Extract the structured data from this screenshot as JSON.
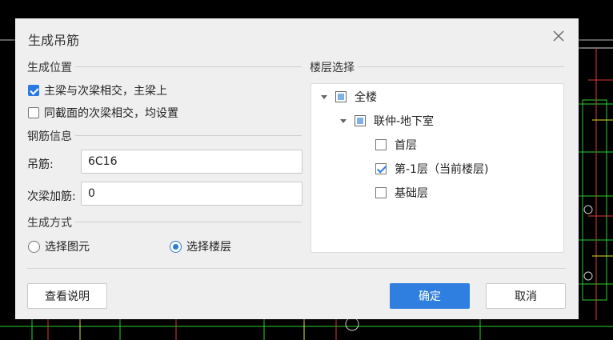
{
  "dialog": {
    "title": "生成吊筋",
    "close_icon": "close-icon"
  },
  "position_section": {
    "label": "生成位置",
    "options": [
      {
        "label": "主梁与次梁相交，主梁上",
        "checked": true
      },
      {
        "label": "同截面的次梁相交，均设置",
        "checked": false
      }
    ]
  },
  "rebar_section": {
    "label": "钢筋信息",
    "hanger_label": "吊筋:",
    "hanger_value": "6C16",
    "secondary_label": "次梁加筋:",
    "secondary_value": "0"
  },
  "method_section": {
    "label": "生成方式",
    "options": [
      {
        "label": "选择图元",
        "selected": false
      },
      {
        "label": "选择楼层",
        "selected": true
      }
    ]
  },
  "floor_section": {
    "label": "楼层选择",
    "tree": [
      {
        "label": "全楼",
        "level": 0,
        "state": "partial",
        "expandable": true
      },
      {
        "label": "联仲-地下室",
        "level": 1,
        "state": "partial",
        "expandable": true
      },
      {
        "label": "首层",
        "level": 2,
        "state": "unchecked",
        "expandable": false
      },
      {
        "label": "第-1层（当前楼层)",
        "level": 2,
        "state": "checked",
        "expandable": false
      },
      {
        "label": "基础层",
        "level": 2,
        "state": "unchecked",
        "expandable": false
      }
    ]
  },
  "buttons": {
    "help": "查看说明",
    "ok": "确定",
    "cancel": "取消"
  },
  "colors": {
    "accent": "#2f7fe0",
    "dialog_bg": "#efefef",
    "cad_bg": "#000000"
  }
}
